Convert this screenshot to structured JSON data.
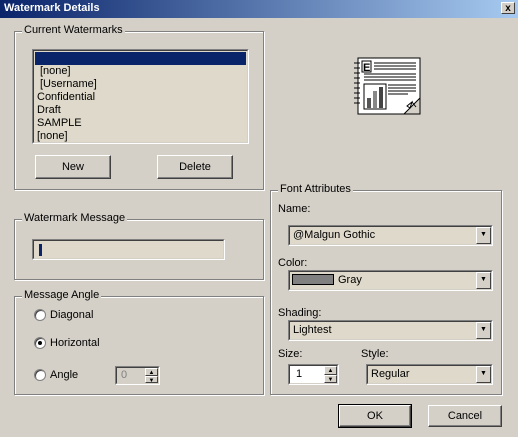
{
  "window": {
    "title": "Watermark Details",
    "close_glyph": "x"
  },
  "current_watermarks": {
    "legend": "Current Watermarks",
    "items": [
      "",
      "[none]",
      "[Username]",
      "Confidential",
      "Draft",
      "SAMPLE",
      "[none]"
    ],
    "selected_index": 0,
    "new_label": "New",
    "delete_label": "Delete"
  },
  "watermark_message": {
    "legend": "Watermark Message",
    "value": ""
  },
  "message_angle": {
    "legend": "Message Angle",
    "diagonal_label": "Diagonal",
    "horizontal_label": "Horizontal",
    "angle_label": "Angle",
    "angle_value": "0",
    "selected": "Horizontal"
  },
  "font_attributes": {
    "legend": "Font Attributes",
    "name_label": "Name:",
    "name_value": "@Malgun Gothic",
    "color_label": "Color:",
    "color_value": "Gray",
    "color_swatch": "#808080",
    "shading_label": "Shading:",
    "shading_value": "Lightest",
    "size_label": "Size:",
    "size_value": "1",
    "style_label": "Style:",
    "style_value": "Regular"
  },
  "buttons": {
    "ok": "OK",
    "cancel": "Cancel"
  },
  "icons": {
    "preview": "document-preview-icon"
  }
}
